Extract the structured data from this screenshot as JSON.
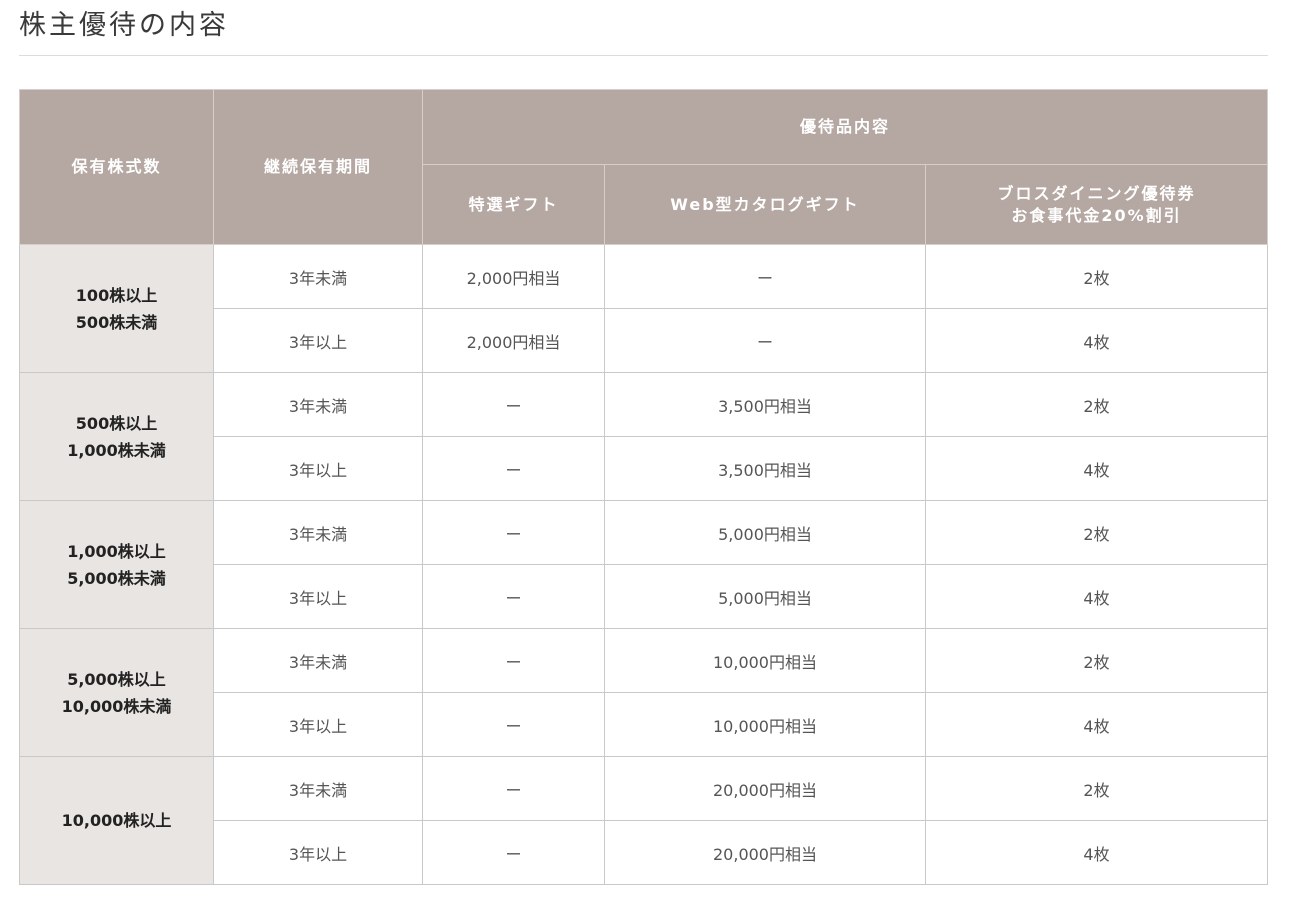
{
  "page": {
    "title": "株主優待の内容"
  },
  "table": {
    "headers": {
      "shares": "保有株式数",
      "period": "継続保有期間",
      "content_group": "優待品内容",
      "gift": "特選ギフト",
      "catalog": "Web型カタログギフト",
      "dining_line1": "ブロスダイニング優待券",
      "dining_line2": "お食事代金20%割引"
    },
    "groups": [
      {
        "shares_line1": "100株以上",
        "shares_line2": "500株未満",
        "rows": [
          {
            "period": "3年未満",
            "gift": "2,000円相当",
            "catalog": "ー",
            "dining": "2枚"
          },
          {
            "period": "3年以上",
            "gift": "2,000円相当",
            "catalog": "ー",
            "dining": "4枚"
          }
        ]
      },
      {
        "shares_line1": "500株以上",
        "shares_line2": "1,000株未満",
        "rows": [
          {
            "period": "3年未満",
            "gift": "ー",
            "catalog": "3,500円相当",
            "dining": "2枚"
          },
          {
            "period": "3年以上",
            "gift": "ー",
            "catalog": "3,500円相当",
            "dining": "4枚"
          }
        ]
      },
      {
        "shares_line1": "1,000株以上",
        "shares_line2": "5,000株未満",
        "rows": [
          {
            "period": "3年未満",
            "gift": "ー",
            "catalog": "5,000円相当",
            "dining": "2枚"
          },
          {
            "period": "3年以上",
            "gift": "ー",
            "catalog": "5,000円相当",
            "dining": "4枚"
          }
        ]
      },
      {
        "shares_line1": "5,000株以上",
        "shares_line2": "10,000株未満",
        "rows": [
          {
            "period": "3年未満",
            "gift": "ー",
            "catalog": "10,000円相当",
            "dining": "2枚"
          },
          {
            "period": "3年以上",
            "gift": "ー",
            "catalog": "10,000円相当",
            "dining": "4枚"
          }
        ]
      },
      {
        "shares_line1": "10,000株以上",
        "shares_line2": "",
        "rows": [
          {
            "period": "3年未満",
            "gift": "ー",
            "catalog": "20,000円相当",
            "dining": "2枚"
          },
          {
            "period": "3年以上",
            "gift": "ー",
            "catalog": "20,000円相当",
            "dining": "4枚"
          }
        ]
      }
    ]
  }
}
